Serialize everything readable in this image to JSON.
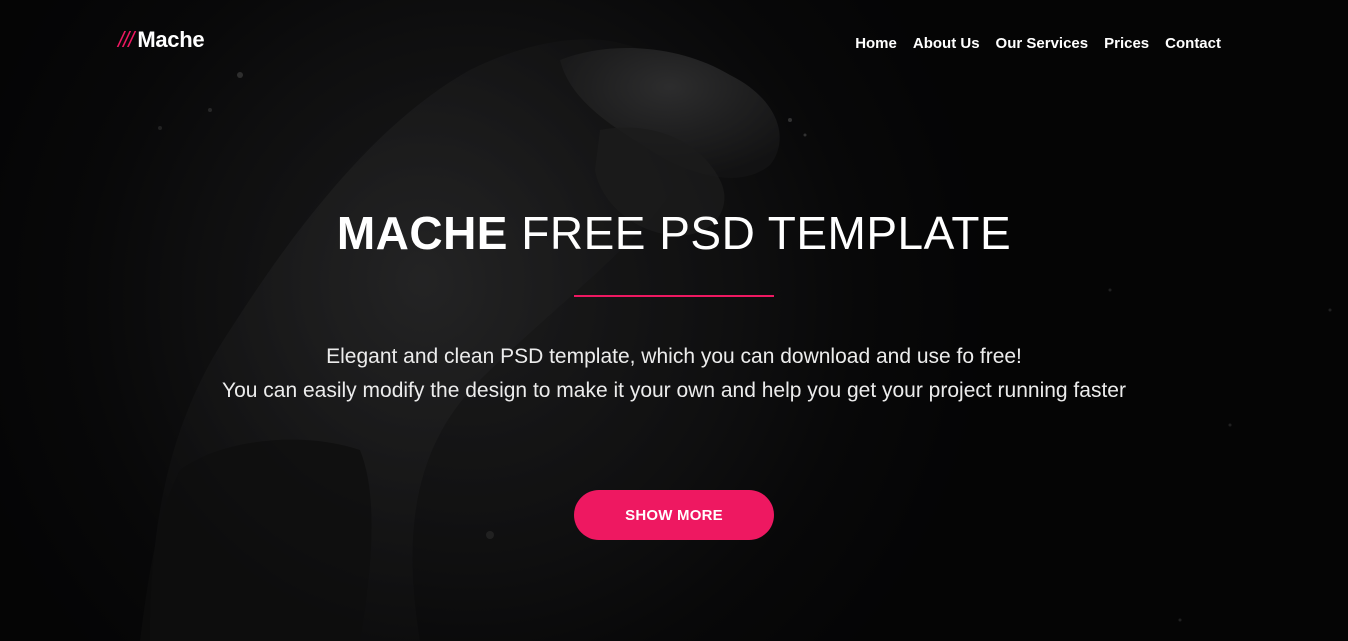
{
  "header": {
    "logo_slashes": "///",
    "logo_text": "Mache",
    "nav": [
      {
        "label": "Home"
      },
      {
        "label": "About Us"
      },
      {
        "label": "Our Services"
      },
      {
        "label": "Prices"
      },
      {
        "label": "Contact"
      }
    ]
  },
  "hero": {
    "title_strong": "MACHE",
    "title_light": "FREE PSD TEMPLATE",
    "line1": "Elegant and clean PSD template, which you can download and use fo free!",
    "line2": "You can easily modify the design to make it your own and help you get your project running faster",
    "button_label": "SHOW MORE"
  },
  "colors": {
    "accent": "#ee1861",
    "background": "#0b0b0c",
    "text": "#ffffff"
  }
}
